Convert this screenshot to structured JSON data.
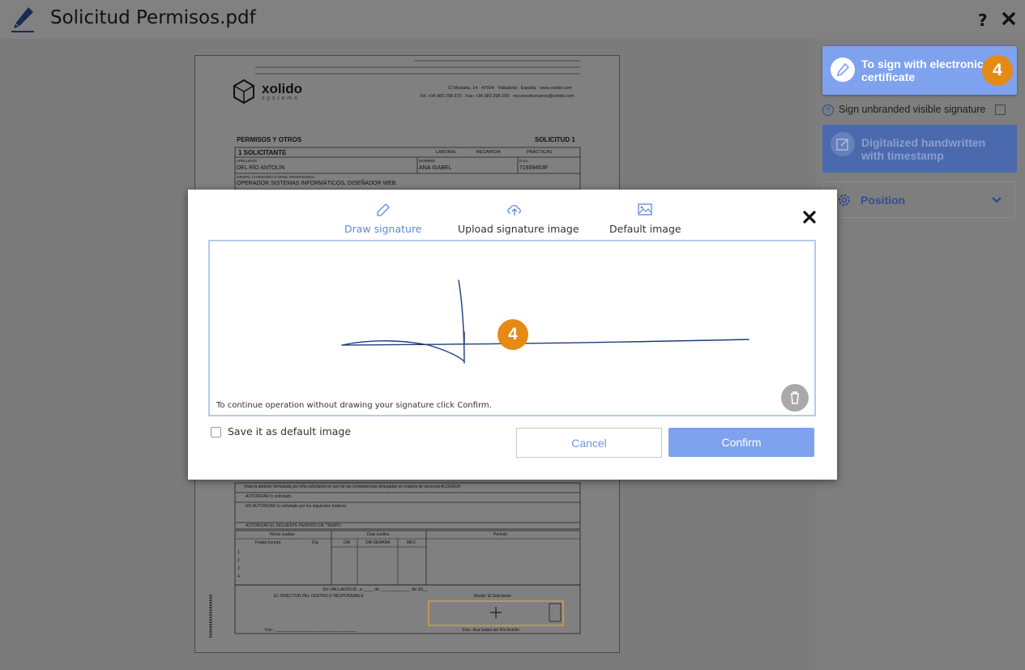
{
  "header": {
    "title": "Solicitud Permisos.pdf",
    "help": "?"
  },
  "document": {
    "company": "xolido",
    "company_sub": "systems",
    "address": "C/ Martaña, 14 · 47004 · Valladolid · España · www.xolido.com",
    "contact": "Tel: +34 983 298 272 · Fax: +34 983 298 209 · recursoshumanos@xolido.com",
    "form_title": "PERMISOS Y OTROS",
    "form_number": "SOLICITUD   1",
    "section1": "1  SOLICITANTE",
    "options": [
      "LABORAL",
      "BECARIO/A",
      "PRÁCTICAS"
    ],
    "fields": {
      "apellidos_label": "APELLIDOS",
      "apellidos": "DEL RÍO ANTOLÍN",
      "nombre_label": "NOMBRE",
      "nombre": "ANA ISABEL",
      "dni_label": "D.N.I.",
      "dni": "71939453F",
      "grupo_label": "GRUPO, CATEGORÍA O NIVEL PROFESIONAL",
      "grupo": "OPERADOR SISTEMAS INFORMÁTICOS, DISEÑADOR WEB."
    },
    "lower": {
      "intro": "Vista la petición formulada por el/la solicitante en uso de las competencias delegadas en materia de personal ACUERDA",
      "opt1": "AUTORIZAR lo solicitado.",
      "opt2": "NO AUTORIZAR lo solicitado por los siguientes motivos:",
      "opt3": "AUTORIZAR EL SIGUIENTE PERIODO DE TIEMPO",
      "col_horas": "Horas sueltas",
      "col_franja": "Franja horaria",
      "col_dia": "Día",
      "col_dias": "Días sueltos",
      "col_d": "DÍA",
      "col_semana": "DÍA SEMANA",
      "col_mes": "MES",
      "col_periodo": "Periodo",
      "row_prefix": [
        "1",
        "2",
        "3",
        "4"
      ],
      "place": "En        VALLADOLID        ,a ____ de ____________ de  20__",
      "director": "EL DIRECTOR DEL CENTRO O RESPONSABLE",
      "received": "Recibí: El Solicitante",
      "fdo_left": "Fdo.: ____________________________________",
      "fdo_right": "Fdo.: Ana Isabel del Río Antolín"
    }
  },
  "sidebar": {
    "cert_button": "To sign with electronic certificate",
    "cert_badge": "4",
    "unbranded_label": "Sign unbranded visible signature",
    "handwritten_button": "Digitalized handwritten with timestamp",
    "position_label": "Position"
  },
  "modal": {
    "tabs": [
      "Draw signature",
      "Upload signature image",
      "Default image"
    ],
    "active_tab": "Draw signature",
    "hint": "To continue operation without drawing your signature click Confirm.",
    "canvas_badge": "4",
    "save_default": "Save it as default image",
    "cancel": "Cancel",
    "confirm": "Confirm"
  },
  "colors": {
    "accent": "#7ea2ee",
    "accent_dark": "#4b6aad",
    "badge": "#e58a14",
    "tab_active": "#5b8ad6",
    "ink": "#1e3c7a"
  }
}
